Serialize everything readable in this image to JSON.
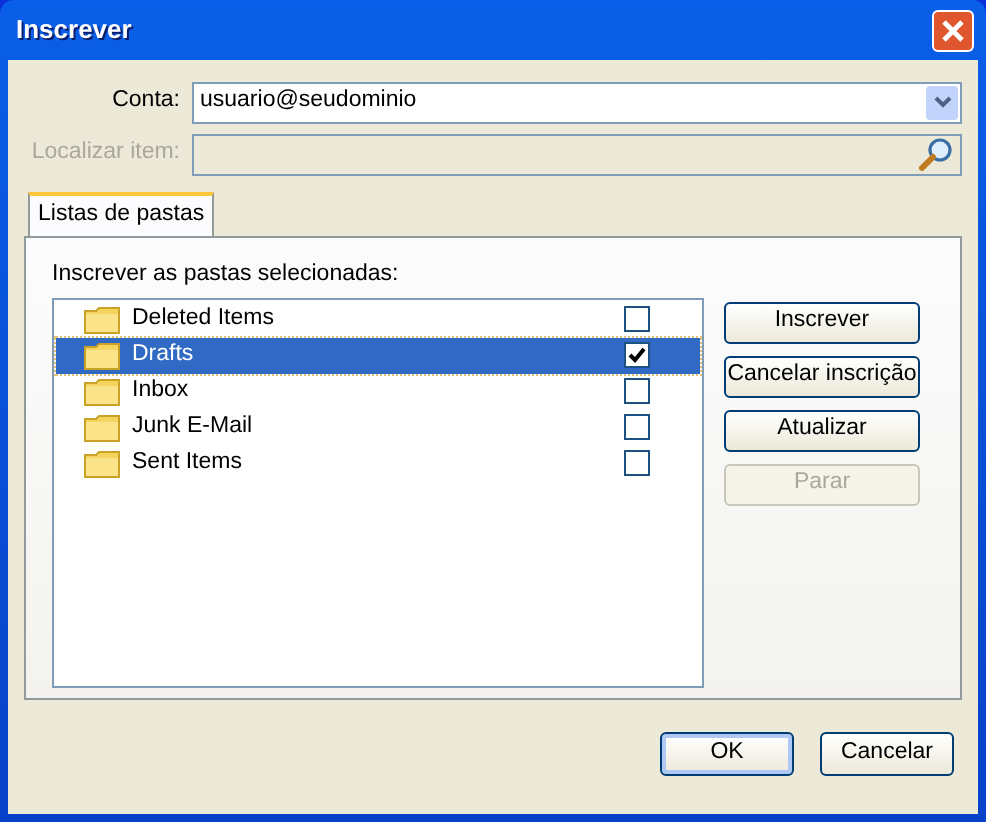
{
  "window": {
    "title": "Inscrever"
  },
  "account": {
    "label": "Conta:",
    "value": "usuario@seudominio"
  },
  "find": {
    "label": "Localizar item:",
    "disabled": true
  },
  "tabs": [
    {
      "label": "Listas de pastas",
      "selected": true
    }
  ],
  "list_label": "Inscrever as pastas selecionadas:",
  "folders": [
    {
      "name": "Deleted Items",
      "checked": false,
      "selected": false
    },
    {
      "name": "Drafts",
      "checked": true,
      "selected": true
    },
    {
      "name": "Inbox",
      "checked": false,
      "selected": false
    },
    {
      "name": "Junk E-Mail",
      "checked": false,
      "selected": false
    },
    {
      "name": "Sent Items",
      "checked": false,
      "selected": false
    }
  ],
  "side_buttons": [
    {
      "label": "Inscrever",
      "disabled": false
    },
    {
      "label": "Cancelar inscrição",
      "disabled": false
    },
    {
      "label": "Atualizar",
      "disabled": false
    },
    {
      "label": "Parar",
      "disabled": true
    }
  ],
  "footer_buttons": [
    {
      "label": "OK",
      "default": true
    },
    {
      "label": "Cancelar",
      "default": false
    }
  ]
}
